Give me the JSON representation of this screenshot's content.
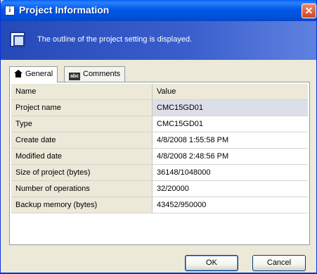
{
  "window": {
    "title": "Project Information",
    "title_icon": "i",
    "close_glyph": "✕"
  },
  "header": {
    "icon": "info-icon",
    "message": "The outline of the project setting is displayed."
  },
  "tabs": [
    {
      "label": "General",
      "icon": "house-icon",
      "active": true
    },
    {
      "label": "Comments",
      "icon": "abc-icon",
      "active": false
    }
  ],
  "table": {
    "columns": [
      "Name",
      "Value"
    ],
    "rows": [
      {
        "name": "Project name",
        "value": "CMC15GD01"
      },
      {
        "name": "Type",
        "value": "CMC15GD01"
      },
      {
        "name": "Create date",
        "value": "4/8/2008 1:55:58 PM"
      },
      {
        "name": "Modified date",
        "value": "4/8/2008 2:48:56 PM"
      },
      {
        "name": "Size of project (bytes)",
        "value": "36148/1048000"
      },
      {
        "name": "Number of operations",
        "value": "32/20000"
      },
      {
        "name": "Backup memory (bytes)",
        "value": "43452/950000"
      }
    ],
    "selected_row": "Project name"
  },
  "buttons": {
    "ok": "OK",
    "cancel": "Cancel"
  },
  "colors": {
    "title_bar": "#0058e6",
    "header_band": "#3a5fcd",
    "dialog_face": "#ece9d8"
  }
}
